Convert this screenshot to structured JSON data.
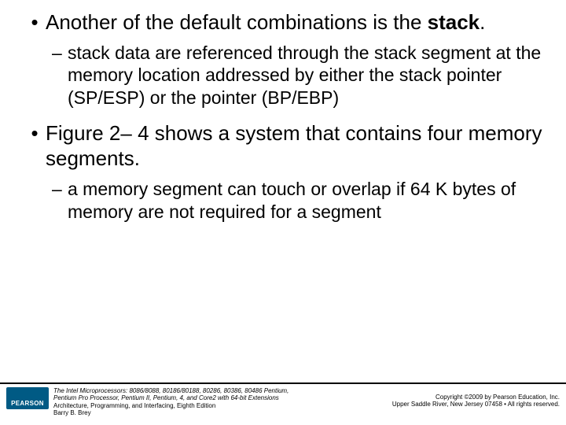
{
  "bullets": {
    "b1_pre": "Another of the default combinations is the ",
    "b1_bold": "stack",
    "b1_post": ".",
    "b1_sub": "stack data are referenced through the stack segment at the memory location addressed by either the stack pointer (SP/ESP) or the pointer (BP/EBP)",
    "b2": "Figure 2– 4 shows a system that contains four memory segments.",
    "b2_sub": "a memory segment can touch or overlap if 64 K bytes of memory are not required for a segment"
  },
  "footer": {
    "logo": "PEARSON",
    "book_title": "The Intel Microprocessors: 8086/8088, 80186/80188, 80286, 80386, 80486 Pentium,",
    "book_title2": "Pentium Pro Processor, Pentium II, Pentium, 4, and Core2 with 64-bit Extensions",
    "book_sub": "Architecture, Programming, and Interfacing, Eighth Edition",
    "author": "Barry B. Brey",
    "copyright1": "Copyright ©2009 by Pearson Education, Inc.",
    "copyright2": "Upper Saddle River, New Jersey 07458 • All rights reserved."
  }
}
